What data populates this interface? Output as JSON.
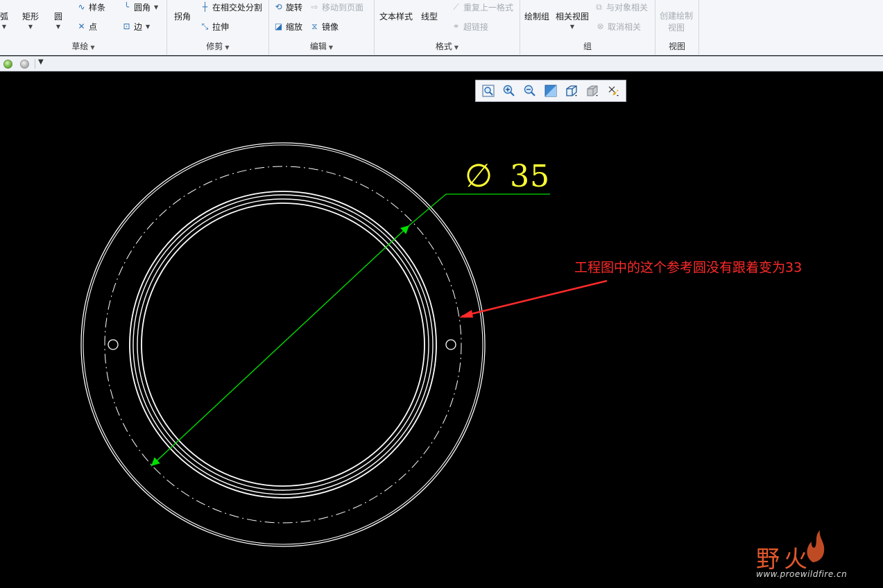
{
  "ribbon": {
    "sketch": {
      "label": "草绘",
      "arc": "弧",
      "rectangle": "矩形",
      "circle": "圆",
      "spline": "样条",
      "point": "点",
      "fillet": "圆角",
      "edge": "边"
    },
    "trim": {
      "label": "修剪",
      "corner": "拐角",
      "split_at_intersection": "在相交处分割",
      "stretch": "拉伸"
    },
    "edit": {
      "label": "编辑",
      "rotate": "旋转",
      "move_to_page": "移动到页面",
      "scale": "缩放",
      "mirror": "镜像"
    },
    "format": {
      "label": "格式",
      "text_style": "文本样式",
      "line_style": "线型",
      "repeat_last_format": "重复上一格式",
      "hyperlink": "超链接"
    },
    "group": {
      "label": "组",
      "draw_group": "绘制组",
      "related_view": "相关视图",
      "relate_to_object": "与对象相关",
      "unrelate": "取消相关"
    },
    "view": {
      "label": "视图",
      "create_drawn_view_line1": "创建绘制",
      "create_drawn_view_line2": "视图"
    }
  },
  "view_toolbar": {
    "icons": [
      "refit-icon",
      "zoom-in-icon",
      "zoom-out-icon",
      "repaint-icon",
      "display-style-icon",
      "saved-orientations-icon",
      "datum-display-icon"
    ]
  },
  "drawing": {
    "dimension_symbol": "∅",
    "dimension_value": "35",
    "annotation": "工程图中的这个参考圆没有跟着变为33"
  },
  "watermark": {
    "brand": "野火",
    "url": "www.proewildfire.cn"
  },
  "colors": {
    "dimension_text": "#ffff33",
    "dimension_lines": "#00e000",
    "annotation": "#ff2a2a",
    "geometry": "#ffffff",
    "logo": "#e0582c"
  }
}
